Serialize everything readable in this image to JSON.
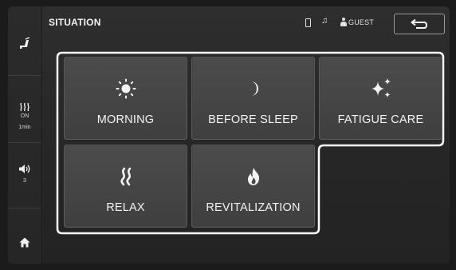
{
  "header": {
    "title": "SITUATION",
    "profile_label": "GUEST"
  },
  "sidebar": {
    "heater_status": "ON",
    "heater_timer": "1min",
    "volume_level": "3"
  },
  "tiles": [
    {
      "label": "MORNING",
      "icon": "sun-icon"
    },
    {
      "label": "BEFORE SLEEP",
      "icon": "moon-icon"
    },
    {
      "label": "FATIGUE CARE",
      "icon": "sparkle-icon"
    },
    {
      "label": "RELAX",
      "icon": "wave-icon"
    },
    {
      "label": "REVITALIZATION",
      "icon": "flame-icon"
    }
  ],
  "colors": {
    "background": "#1b1b1b",
    "tile": "#474747",
    "accent_outline": "#ffffff",
    "text": "#f3f3f3"
  }
}
